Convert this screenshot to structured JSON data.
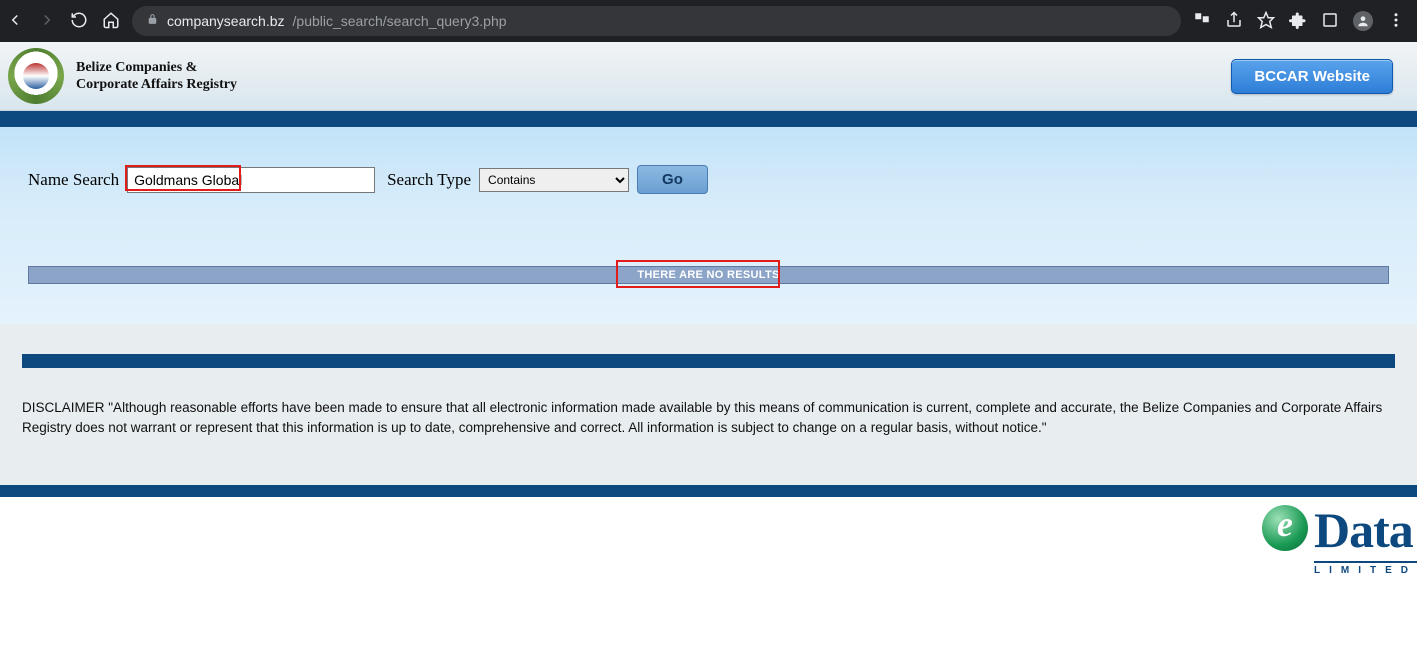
{
  "browser": {
    "url_host": "companysearch.bz",
    "url_path": "/public_search/search_query3.php"
  },
  "header": {
    "registry_name": "Belize Companies &\nCorporate Affairs Registry",
    "bccar_button": "BCCAR Website"
  },
  "search": {
    "name_label": "Name Search",
    "name_value": "Goldmans Global",
    "type_label": "Search Type",
    "type_selected": "Contains",
    "go_label": "Go"
  },
  "results": {
    "no_results": "THERE ARE NO RESULTS"
  },
  "disclaimer": "DISCLAIMER \"Although reasonable efforts have been made to ensure that all electronic information made available by this means of communication is current, complete and accurate, the Belize Companies and Corporate Affairs Registry does not warrant or represent that this information is up to date, comprehensive and correct. All information is subject to change on a regular basis, without notice.\"",
  "footer": {
    "logo_data": "Data",
    "logo_limited": "LIMITED"
  }
}
